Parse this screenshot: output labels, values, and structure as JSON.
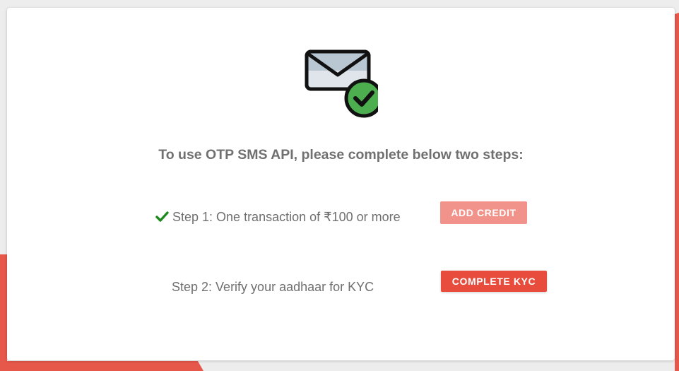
{
  "colors": {
    "accent_red": "#e74c3c",
    "disabled_red": "#f1938a",
    "check_green": "#1e8a1e",
    "text_gray": "#6f6f6f",
    "background_red": "#e5584a"
  },
  "icon": {
    "name": "mail-verified-icon"
  },
  "main": {
    "heading": "To use OTP SMS API, please complete below two steps:"
  },
  "steps": [
    {
      "text": "Step 1: One transaction of ₹100 or more",
      "completed": true,
      "status_icon": "check-icon",
      "button_label": "ADD CREDIT",
      "button_state": "disabled"
    },
    {
      "text": "Step 2: Verify your aadhaar for KYC",
      "completed": false,
      "button_label": "COMPLETE KYC",
      "button_state": "active"
    }
  ]
}
